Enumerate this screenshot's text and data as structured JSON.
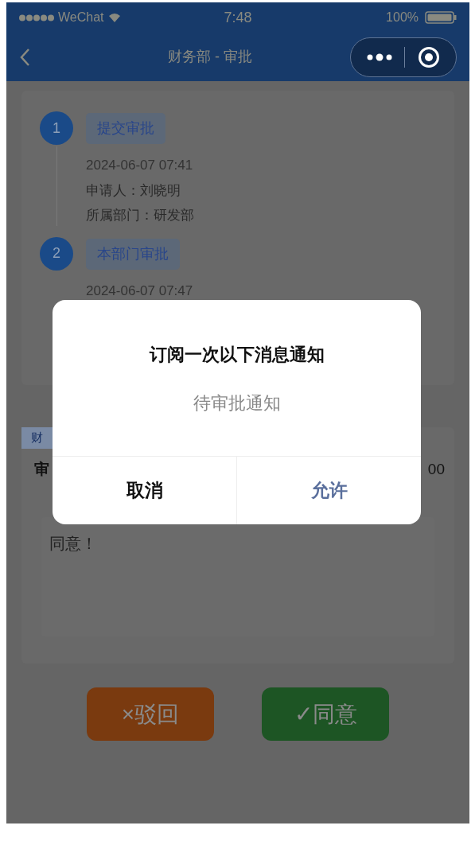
{
  "status_bar": {
    "carrier": "WeChat",
    "time": "7:48",
    "battery": "100%"
  },
  "nav": {
    "title": "财务部 - 审批"
  },
  "steps": [
    {
      "number": "1",
      "label": "提交审批",
      "time": "2024-06-07 07:41",
      "details": [
        "申请人：刘晓明",
        "所属部门：研发部"
      ]
    },
    {
      "number": "2",
      "label": "本部门审批",
      "time": "2024-06-07 07:47"
    }
  ],
  "review": {
    "tag": "财",
    "title": "审",
    "amount": "00",
    "comment": "同意！"
  },
  "actions": [
    {
      "kind": "reject",
      "icon": "×",
      "label": "驳回"
    },
    {
      "kind": "approve",
      "icon": "✓",
      "label": "同意"
    }
  ],
  "dialog": {
    "title": "订阅一次以下消息通知",
    "item": "待审批通知",
    "buttons": [
      {
        "kind": "cancel",
        "label": "取消"
      },
      {
        "kind": "allow",
        "label": "允许"
      }
    ]
  }
}
